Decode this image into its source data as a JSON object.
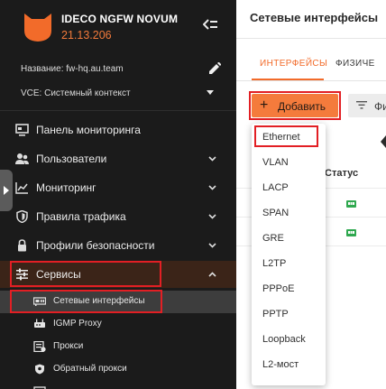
{
  "app": {
    "name": "IDECO NGFW NOVUM",
    "version": "21.13.206"
  },
  "info": {
    "name_line": "Название: fw-hq.au.team",
    "vce_line": "VCE: Системный контекст"
  },
  "nav": [
    {
      "label": "Панель мониторинга",
      "icon": "monitor-icon"
    },
    {
      "label": "Пользователи",
      "icon": "users-icon"
    },
    {
      "label": "Мониторинг",
      "icon": "chart-line-icon"
    },
    {
      "label": "Правила трафика",
      "icon": "shield-icon"
    },
    {
      "label": "Профили безопасности",
      "icon": "lock-icon"
    },
    {
      "label": "Сервисы",
      "icon": "sliders-icon"
    }
  ],
  "sub_nav": [
    {
      "label": "Сетевые интерфейсы",
      "icon": "network-card-icon"
    },
    {
      "label": "IGMP Proxy",
      "icon": "router-icon"
    },
    {
      "label": "Прокси",
      "icon": "proxy-icon"
    },
    {
      "label": "Обратный прокси",
      "icon": "shield-small-icon"
    },
    {
      "label": "",
      "icon": "vpn-icon"
    }
  ],
  "main": {
    "title": "Сетевые интерфейсы",
    "tabs": [
      "ИНТЕРФЕЙСЫ",
      "ФИЗИЧЕ"
    ],
    "add_button": "Добавить",
    "filter_button": "Фи",
    "status_header": "Статус"
  },
  "add_menu": [
    "Ethernet",
    "VLAN",
    "LACP",
    "SPAN",
    "GRE",
    "L2TP",
    "PPPoE",
    "PPTP",
    "Loopback",
    "L2-мост"
  ],
  "colors": {
    "accent": "#f47b3c",
    "sidebar_bg": "#1b1b1b",
    "highlight_border": "#e21f24",
    "status_green": "#2fa84f"
  }
}
